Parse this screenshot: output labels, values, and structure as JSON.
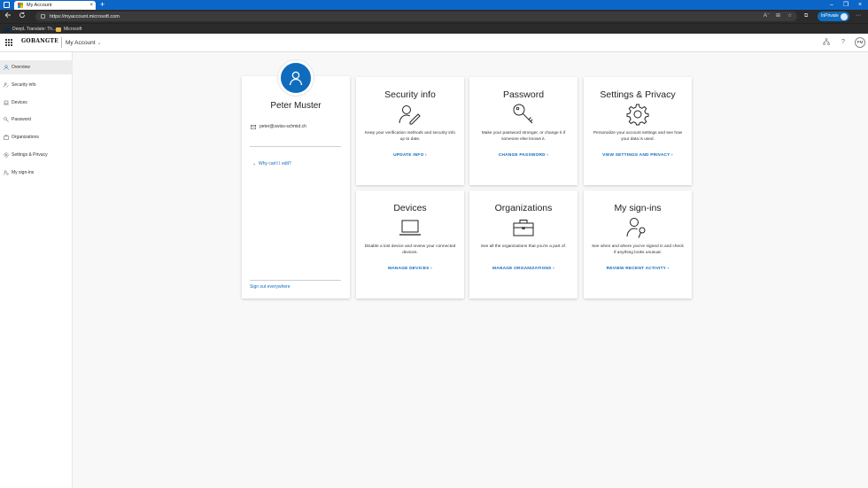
{
  "browser": {
    "tab_title": "My Account",
    "tab_close": "×",
    "new_tab": "+",
    "url": "https://myaccount.microsoft.com",
    "inprivate_label": "InPrivate",
    "window_controls": [
      "–",
      "❐",
      "×"
    ],
    "favorites": [
      {
        "label": "DeepL Translate: Th...",
        "icon": "deepl-icon"
      },
      {
        "label": "Microsoft",
        "icon": "folder-icon"
      }
    ]
  },
  "header": {
    "org_logo": "GOBANGTE",
    "title": "My Account",
    "avatar_initials": "PM"
  },
  "sidebar": {
    "items": [
      {
        "label": "Overview",
        "icon": "person-icon"
      },
      {
        "label": "Security info",
        "icon": "security-info-icon"
      },
      {
        "label": "Devices",
        "icon": "laptop-icon"
      },
      {
        "label": "Password",
        "icon": "key-icon"
      },
      {
        "label": "Organizations",
        "icon": "briefcase-icon"
      },
      {
        "label": "Settings & Privacy",
        "icon": "gear-icon"
      },
      {
        "label": "My sign-ins",
        "icon": "signins-icon"
      }
    ]
  },
  "profile": {
    "name": "Peter Muster",
    "email": "peter@swiss-schmid.ch",
    "why_cant_edit": "Why can't I edit?",
    "sign_out_everywhere": "Sign out everywhere"
  },
  "tiles": [
    {
      "title": "Security info",
      "description": "Keep your verification methods and security info up to date.",
      "link": "UPDATE INFO",
      "icon": "security-info-icon"
    },
    {
      "title": "Password",
      "description": "Make your password stronger, or change it if someone else knows it.",
      "link": "CHANGE PASSWORD",
      "icon": "key-icon"
    },
    {
      "title": "Settings & Privacy",
      "description": "Personalize your account settings and see how your data is used.",
      "link": "VIEW SETTINGS AND PRIVACY",
      "icon": "gear-icon"
    },
    {
      "title": "Devices",
      "description": "Disable a lost device and review your connected devices.",
      "link": "MANAGE DEVICES",
      "icon": "laptop-icon"
    },
    {
      "title": "Organizations",
      "description": "See all the organizations that you're a part of.",
      "link": "MANAGE ORGANIZATIONS",
      "icon": "briefcase-icon"
    },
    {
      "title": "My sign-ins",
      "description": "See when and where you've signed in and check if anything looks unusual.",
      "link": "REVIEW RECENT ACTIVITY",
      "icon": "signins-icon"
    }
  ],
  "colors": {
    "accent": "#0f6cbd",
    "titlebar": "#0c66c8",
    "toolbar": "#2b2b2b",
    "page_bg": "#f8f8f8"
  }
}
